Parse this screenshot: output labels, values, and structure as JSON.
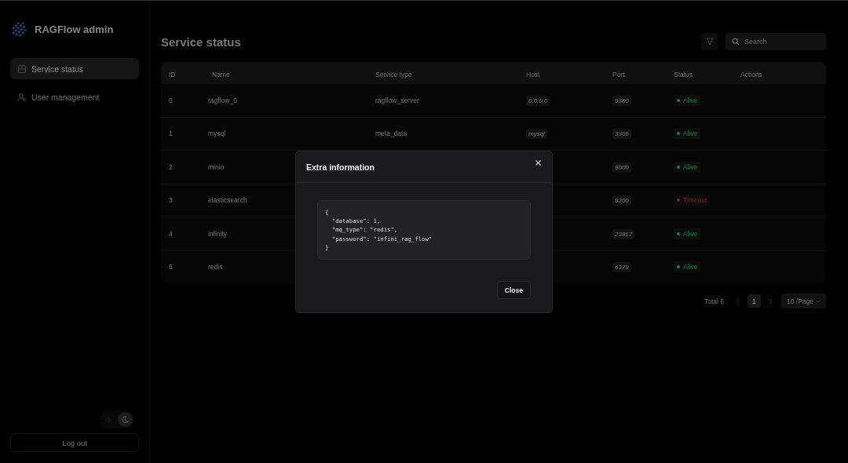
{
  "sidebar": {
    "brand": "RAGFlow admin",
    "items": [
      {
        "label": "Service status",
        "selected": true
      },
      {
        "label": "User management",
        "selected": false
      }
    ],
    "theme_toggle": [
      {
        "kind": "sun",
        "selected": false
      },
      {
        "kind": "moon",
        "selected": true
      }
    ],
    "logout": "Log out"
  },
  "page": {
    "title": "Service status",
    "search": {
      "placeholder": "Search"
    }
  },
  "table": {
    "columns": [
      "ID",
      "Name",
      "Service type",
      "Host",
      "Port",
      "Status",
      "Actions"
    ],
    "rows": [
      {
        "id": "0",
        "name": "ragflow_0",
        "service_type": "ragflow_server",
        "host": "0.0.0.0",
        "port": "9380",
        "status": "Alive",
        "color": "#1f7a45"
      },
      {
        "id": "1",
        "name": "mysql",
        "service_type": "meta_data",
        "host": "mysql",
        "port": "3306",
        "status": "Alive",
        "color": "#1f7a45"
      },
      {
        "id": "2",
        "name": "minio",
        "port": "9000",
        "status": "Alive",
        "color": "#1f7a45"
      },
      {
        "id": "3",
        "name": "elasticsearch",
        "port": "9200",
        "status": "Timeout",
        "color": "#7a1f24"
      },
      {
        "id": "4",
        "name": "infinity",
        "port": "23817",
        "status": "Alive",
        "color": "#1f7a45"
      },
      {
        "id": "5",
        "name": "redis",
        "port": "6379",
        "status": "Alive",
        "color": "#1f7a45"
      }
    ]
  },
  "pagination": {
    "total": "Total 6",
    "pages": [
      {
        "label": "1",
        "selected": true
      }
    ],
    "page_size": "10 /Page"
  },
  "dialog": {
    "title": "Extra information",
    "code": "{\n  \"database\": 1,\n  \"mq_type\": \"redis\",\n  \"password\": \"infini_rag_flow\"\n}",
    "button": "Close"
  }
}
